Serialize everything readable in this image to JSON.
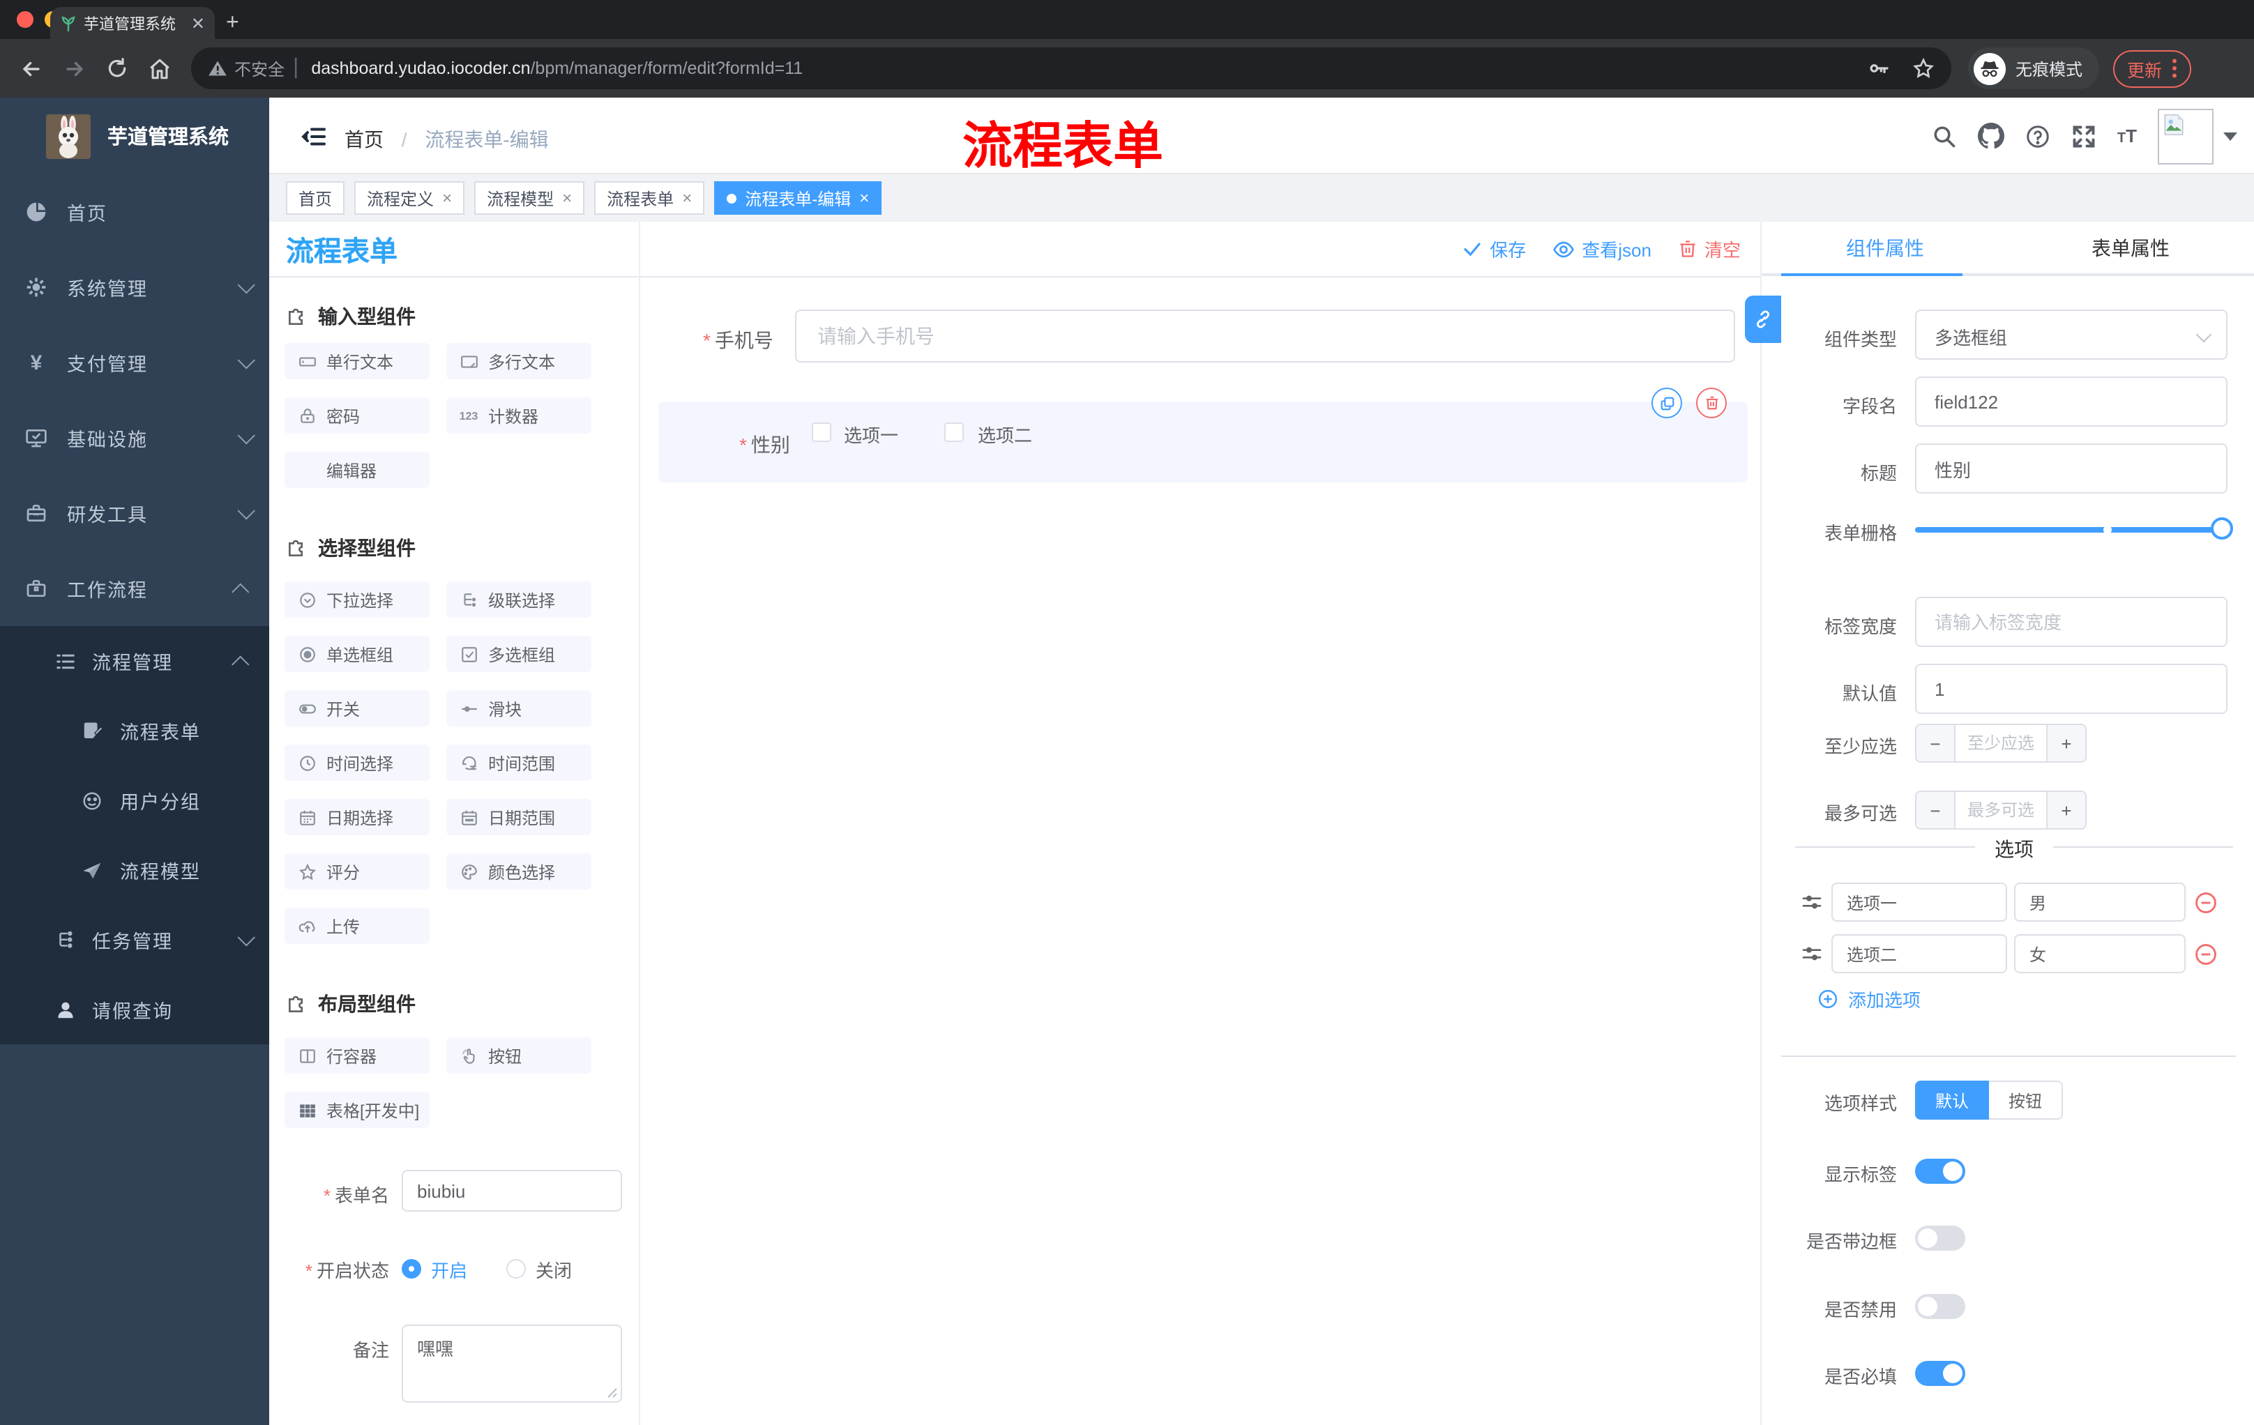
{
  "browser": {
    "tab_title": "芋道管理系统",
    "security": "不安全",
    "url_domain": "dashboard.yudao.iocoder.cn",
    "url_path": "/bpm/manager/form/edit?formId=11",
    "incognito": "无痕模式",
    "update": "更新"
  },
  "header": {
    "breadcrumb_home": "首页",
    "breadcrumb_sep": "/",
    "breadcrumb_current": "流程表单-编辑",
    "overlay_title": "流程表单"
  },
  "sidebar": {
    "title": "芋道管理系统",
    "home": "首页",
    "system": "系统管理",
    "pay": "支付管理",
    "infra": "基础设施",
    "devtool": "研发工具",
    "workflow": "工作流程",
    "process_mgmt": "流程管理",
    "process_form": "流程表单",
    "user_group": "用户分组",
    "process_model": "流程模型",
    "task_mgmt": "任务管理",
    "leave_query": "请假查询"
  },
  "tags": {
    "home": "首页",
    "def": "流程定义",
    "model": "流程模型",
    "form": "流程表单",
    "active": "流程表单-编辑",
    "close": "×"
  },
  "palette": {
    "page_title": "流程表单",
    "group_input": "输入型组件",
    "group_select": "选择型组件",
    "group_layout": "布局型组件",
    "items_input": [
      "单行文本",
      "多行文本",
      "密码",
      "计数器",
      "编辑器"
    ],
    "items_select": [
      "下拉选择",
      "级联选择",
      "单选框组",
      "多选框组",
      "开关",
      "滑块",
      "时间选择",
      "时间范围",
      "日期选择",
      "日期范围",
      "评分",
      "颜色选择",
      "上传"
    ],
    "items_layout": [
      "行容器",
      "按钮",
      "表格[开发中]"
    ]
  },
  "meta_form": {
    "name_label": "表单名",
    "name_value": "biubiu",
    "status_label": "开启状态",
    "status_on": "开启",
    "status_off": "关闭",
    "remark_label": "备注",
    "remark_value": "嘿嘿"
  },
  "canvas": {
    "save": "保存",
    "view_json": "查看json",
    "clear": "清空",
    "phone_label": "手机号",
    "phone_placeholder": "请输入手机号",
    "gender_label": "性别",
    "gender_opt1": "选项一",
    "gender_opt2": "选项二"
  },
  "props": {
    "tab_component": "组件属性",
    "tab_form": "表单属性",
    "type_label": "组件类型",
    "type_value": "多选框组",
    "field_label": "字段名",
    "field_value": "field122",
    "title_label": "标题",
    "title_value": "性别",
    "grid_label": "表单栅格",
    "label_width_label": "标签宽度",
    "label_width_placeholder": "请输入标签宽度",
    "default_label": "默认值",
    "default_value": "1",
    "min_label": "至少应选",
    "min_placeholder": "至少应选",
    "max_label": "最多可选",
    "max_placeholder": "最多可选",
    "minus": "−",
    "plus": "+",
    "options_divider": "选项",
    "options": [
      {
        "label": "选项一",
        "value": "男"
      },
      {
        "label": "选项二",
        "value": "女"
      }
    ],
    "add_option": "添加选项",
    "style_label": "选项样式",
    "style_default": "默认",
    "style_button": "按钮",
    "toggle_show_label": "显示标签",
    "toggle_border": "是否带边框",
    "toggle_disabled": "是否禁用",
    "toggle_required": "是否必填",
    "toggle_states": {
      "show_label": true,
      "border": false,
      "disabled": false,
      "required": true
    }
  },
  "colors": {
    "primary": "#409eff",
    "danger": "#f56c6c",
    "sidebar_bg": "#304156",
    "submenu_bg": "#1f2d3d",
    "page_title_blue": "#2fa4f6",
    "overlay_red": "#fe0000"
  }
}
